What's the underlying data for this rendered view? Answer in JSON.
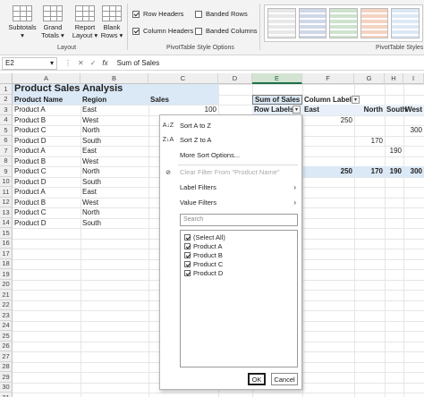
{
  "ribbon": {
    "layout_buttons": [
      {
        "label": "Subtotals",
        "sub": "▾"
      },
      {
        "label": "Grand",
        "sub": "Totals ▾"
      },
      {
        "label": "Report",
        "sub": "Layout ▾"
      },
      {
        "label": "Blank",
        "sub": "Rows ▾"
      }
    ],
    "layout_group": "Layout",
    "style_options": [
      {
        "label": "Row Headers",
        "checked": true
      },
      {
        "label": "Banded Rows",
        "checked": false
      },
      {
        "label": "Column Headers",
        "checked": true
      },
      {
        "label": "Banded Columns",
        "checked": false
      }
    ],
    "style_options_group": "PivotTable Style Options",
    "styles_group": "PivotTable Styles"
  },
  "formula_bar": {
    "name_box": "E2",
    "icons": [
      "⋮",
      "✕",
      "✓"
    ],
    "fx": "fx",
    "content": "Sum of Sales"
  },
  "columns": [
    "A",
    "B",
    "C",
    "D",
    "E",
    "F",
    "G",
    "H",
    "I"
  ],
  "selected_column": "E",
  "rows": [
    "1",
    "2",
    "3",
    "4",
    "5",
    "6",
    "7",
    "8",
    "9",
    "10",
    "11",
    "12",
    "13",
    "14",
    "15",
    "16",
    "17",
    "18",
    "19",
    "20",
    "21",
    "22",
    "23",
    "24",
    "25",
    "26",
    "27",
    "28",
    "29",
    "30",
    "31"
  ],
  "table": {
    "title": "Product Sales Analysis",
    "headers": [
      "Product Name",
      "Region",
      "Sales"
    ],
    "records": [
      [
        "Product A",
        "East",
        "100"
      ],
      [
        "Product B",
        "West",
        ""
      ],
      [
        "Product C",
        "North",
        ""
      ],
      [
        "Product D",
        "South",
        ""
      ],
      [
        "Product A",
        "East",
        ""
      ],
      [
        "Product B",
        "West",
        ""
      ],
      [
        "Product C",
        "North",
        ""
      ],
      [
        "Product D",
        "South",
        ""
      ],
      [
        "Product A",
        "East",
        ""
      ],
      [
        "Product B",
        "West",
        ""
      ],
      [
        "Product C",
        "North",
        ""
      ],
      [
        "Product D",
        "South",
        ""
      ]
    ]
  },
  "pivot": {
    "sum_label": "Sum of Sales",
    "column_labels": "Column Labels",
    "row_labels": "Row Labels",
    "regions": [
      "East",
      "North",
      "South",
      "West"
    ],
    "values": {
      "r4_east": "250",
      "r5_west": "300",
      "r6_north": "170",
      "r7_south": "190"
    },
    "totals": [
      "250",
      "170",
      "190",
      "300"
    ]
  },
  "sort_menu": {
    "sort_az": "Sort A to Z",
    "sort_za": "Sort Z to A",
    "more_sort": "More Sort Options...",
    "clear_filter": "Clear Filter From \"Product Name\"",
    "label_filters": "Label Filters",
    "value_filters": "Value Filters",
    "search_placeholder": "Search",
    "items": [
      {
        "label": "(Select All)",
        "checked": true
      },
      {
        "label": "Product A",
        "checked": true
      },
      {
        "label": "Product B",
        "checked": true
      },
      {
        "label": "Product C",
        "checked": true
      },
      {
        "label": "Product D",
        "checked": true
      }
    ],
    "ok": "OK",
    "cancel": "Cancel"
  }
}
